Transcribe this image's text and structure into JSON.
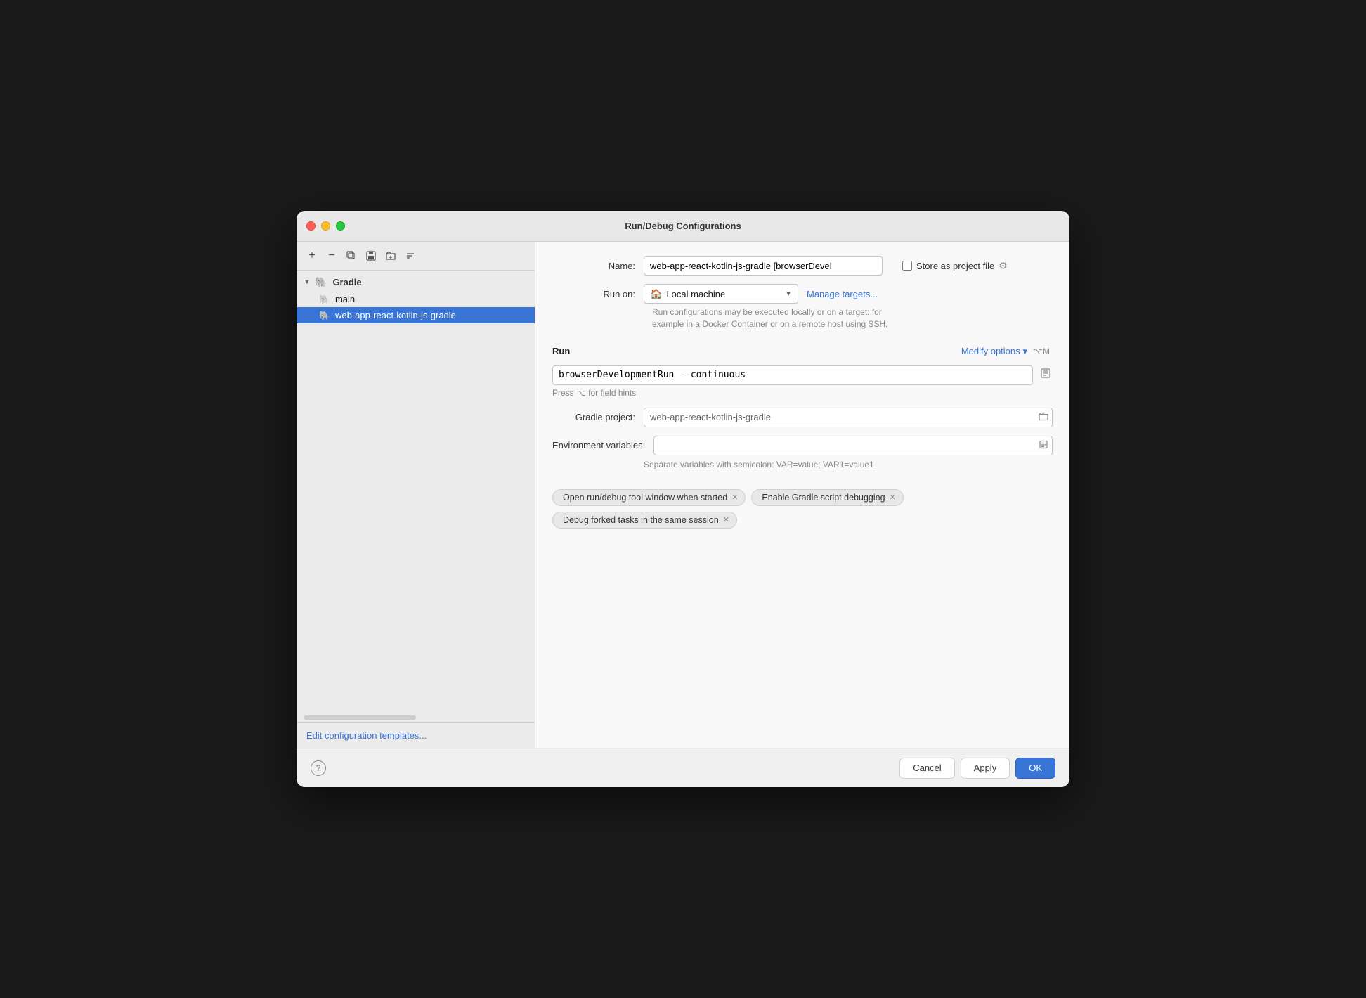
{
  "window": {
    "title": "Run/Debug Configurations"
  },
  "sidebar": {
    "toolbar": {
      "add": "+",
      "remove": "−",
      "copy": "⧉",
      "save": "💾",
      "folder": "📁",
      "sort": "↕"
    },
    "tree": {
      "group_label": "Gradle",
      "group_icon": "🐘",
      "items": [
        {
          "label": "main",
          "selected": false
        },
        {
          "label": "web-app-react-kotlin-js-gradle",
          "selected": true
        }
      ]
    },
    "edit_templates_link": "Edit configuration templates..."
  },
  "form": {
    "name_label": "Name:",
    "name_value": "web-app-react-kotlin-js-gradle [browserDevel",
    "store_project_label": "Store as project file",
    "run_on_label": "Run on:",
    "local_machine_label": "Local machine",
    "manage_targets_link": "Manage targets...",
    "run_on_hint": "Run configurations may be executed locally or on a target: for\nexample in a Docker Container or on a remote host using SSH.",
    "run_section_title": "Run",
    "modify_options_label": "Modify options",
    "modify_options_shortcut": "⌥M",
    "run_command_value": "browserDevelopmentRun --continuous",
    "run_command_hint": "Press ⌥ for field hints",
    "gradle_project_label": "Gradle project:",
    "gradle_project_value": "web-app-react-kotlin-js-gradle",
    "env_vars_label": "Environment variables:",
    "env_vars_value": "",
    "env_vars_hint": "Separate variables with semicolon: VAR=value; VAR1=value1",
    "tags": [
      {
        "label": "Open run/debug tool window when started"
      },
      {
        "label": "Enable Gradle script debugging"
      },
      {
        "label": "Debug forked tasks in the same session"
      }
    ]
  },
  "bottom": {
    "help_label": "?",
    "cancel_label": "Cancel",
    "apply_label": "Apply",
    "ok_label": "OK"
  }
}
